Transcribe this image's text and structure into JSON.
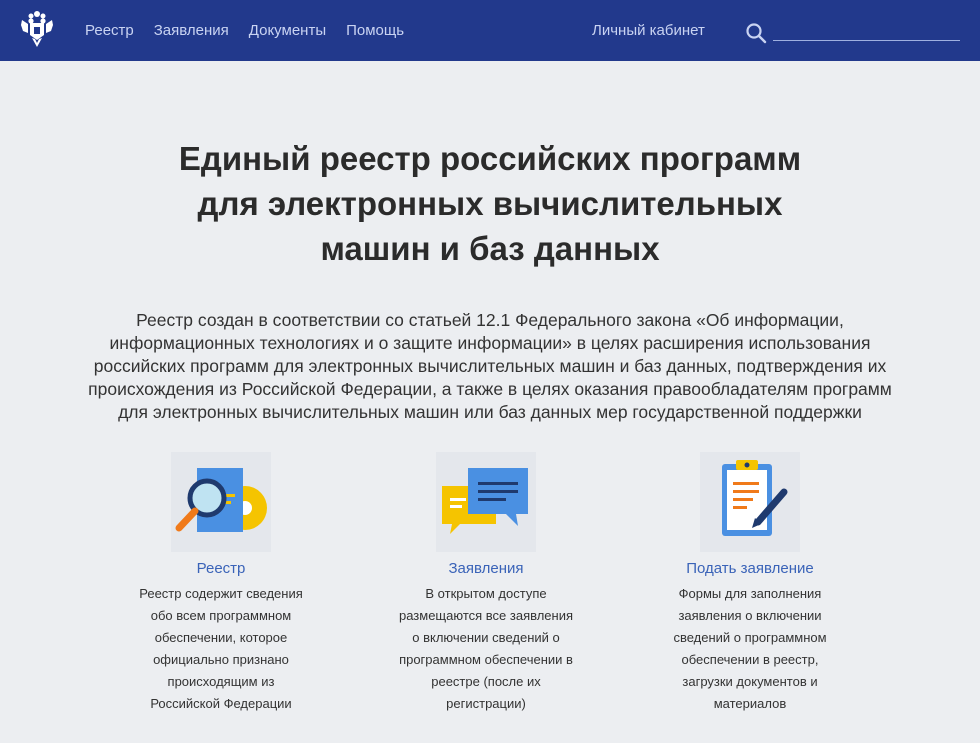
{
  "header": {
    "nav": [
      {
        "label": "Реестр"
      },
      {
        "label": "Заявления"
      },
      {
        "label": "Документы"
      },
      {
        "label": "Помощь"
      }
    ],
    "cabinet_label": "Личный кабинет",
    "search_placeholder": ""
  },
  "main": {
    "title_lines": [
      "Единый реестр российских программ",
      "для электронных вычислительных",
      "машин и баз данных"
    ],
    "intro_lines": [
      "Реестр создан в соответствии со статьей 12.1 Федерального закона «Об информации,",
      "информационных технологиях и о защите информации» в целях расширения использования",
      "российских программ для электронных вычислительных машин и баз данных, подтверждения их",
      "происхождения из Российской Федерации, а также в целях оказания правообладателям программ",
      "для электронных вычислительных машин или баз данных мер государственной поддержки"
    ]
  },
  "cards": [
    {
      "icon": "registry-icon",
      "title": "Реестр",
      "desc_lines": [
        "Реестр содержит сведения",
        "обо всем программном",
        "обеспечении, которое",
        "официально признано",
        "происходящим из",
        "Российской Федерации"
      ]
    },
    {
      "icon": "messages-icon",
      "title": "Заявления",
      "desc_lines": [
        "В открытом доступе",
        "размещаются все заявления",
        "о включении сведений о",
        "программном обеспечении в",
        "реестре (после их",
        "регистрации)"
      ]
    },
    {
      "icon": "clipboard-pen-icon",
      "title": "Подать заявление",
      "desc_lines": [
        "Формы для заполнения",
        "заявления о включении",
        "сведений о программном",
        "обеспечении в реестр,",
        "загрузки документов и",
        "материалов"
      ]
    }
  ],
  "colors": {
    "header_bg": "#22398c",
    "nav_text": "#c9d3f2",
    "link": "#3a63b8",
    "page_bg": "#eceef1"
  }
}
